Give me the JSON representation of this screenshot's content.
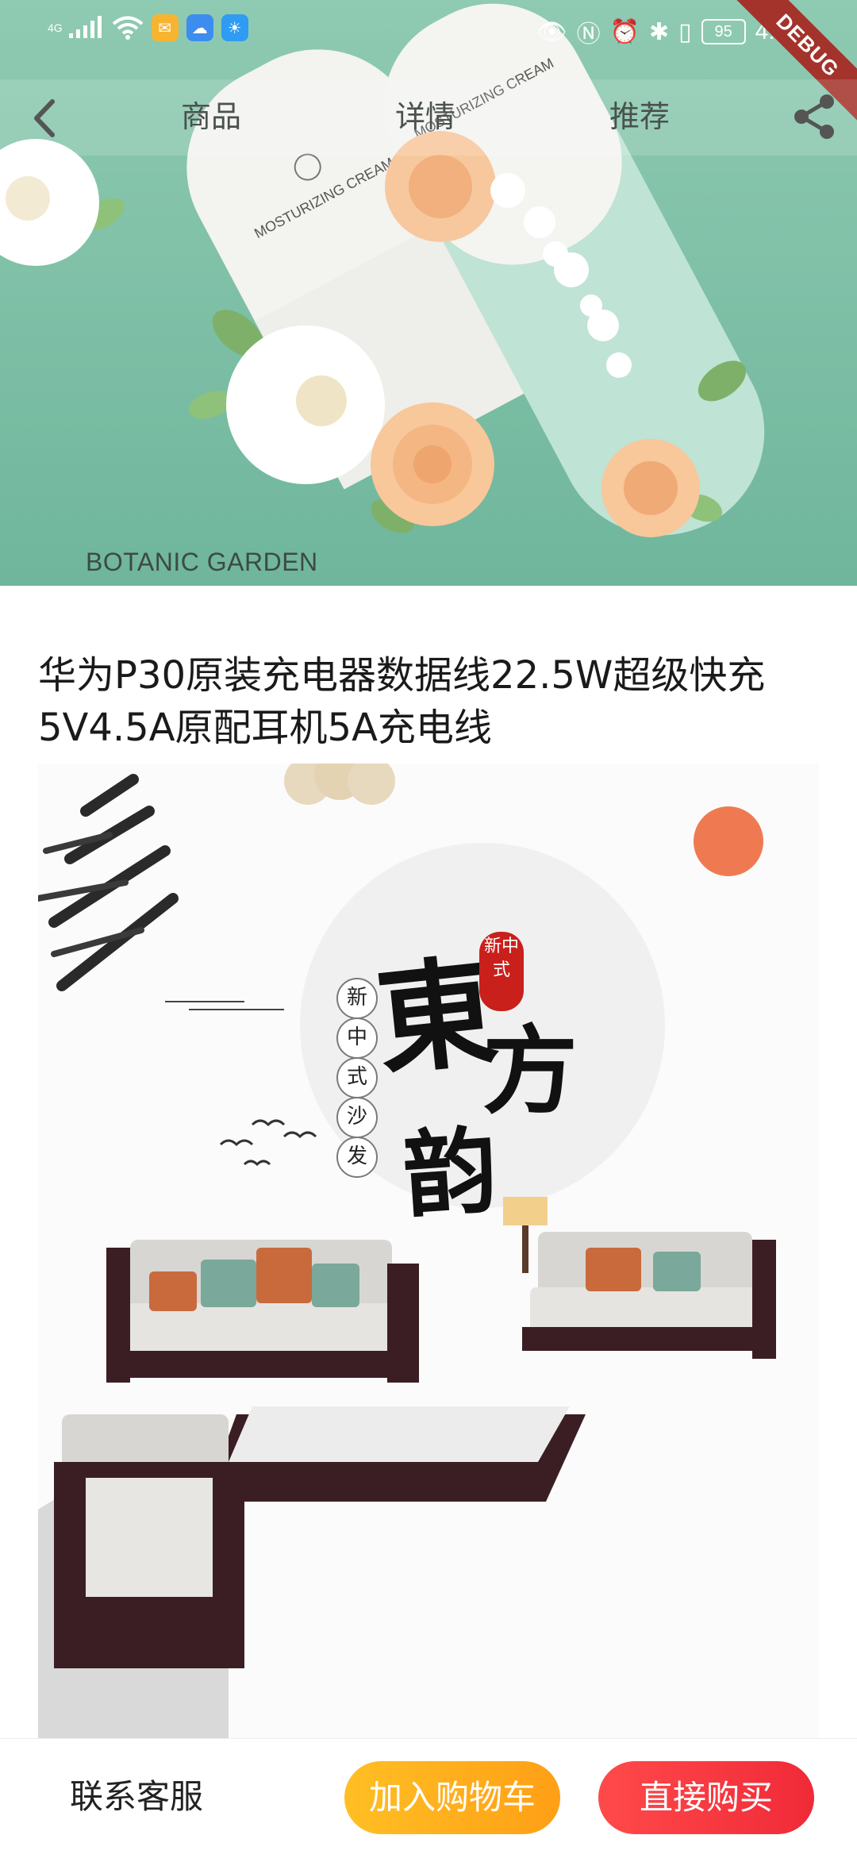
{
  "status_bar": {
    "network": "4G",
    "battery": "95",
    "time": "4:47",
    "icons": [
      "signal-icon",
      "wifi-icon",
      "mail-app-icon",
      "cloud-app-icon",
      "weather-app-icon",
      "eye-icon",
      "nfc-icon",
      "alarm-icon",
      "bluetooth-icon",
      "vibrate-icon",
      "battery-icon"
    ]
  },
  "debug_banner": "DEBUG",
  "nav": {
    "back_icon": "chevron-left-icon",
    "tabs": [
      {
        "label": "商品"
      },
      {
        "label": "详情"
      },
      {
        "label": "推荐"
      }
    ],
    "share_icon": "share-icon"
  },
  "hero": {
    "brand_text": "BOTANIC GARDEN",
    "bg_color": "#7dbfa6"
  },
  "product": {
    "title": "华为P30原装充电器数据线22.5W超级快充5V4.5A原配耳机5A充电线"
  },
  "detail_image": {
    "big_chars": [
      "東",
      "方",
      "韵"
    ],
    "seal_text": "新中式",
    "vertical_chars": [
      "新",
      "中",
      "式",
      "沙",
      "发"
    ]
  },
  "bottom_bar": {
    "service_label": "联系客服",
    "cart_label": "加入购物车",
    "buy_label": "直接购买",
    "cart_color": "#ffad1c",
    "buy_color": "#f23140"
  }
}
